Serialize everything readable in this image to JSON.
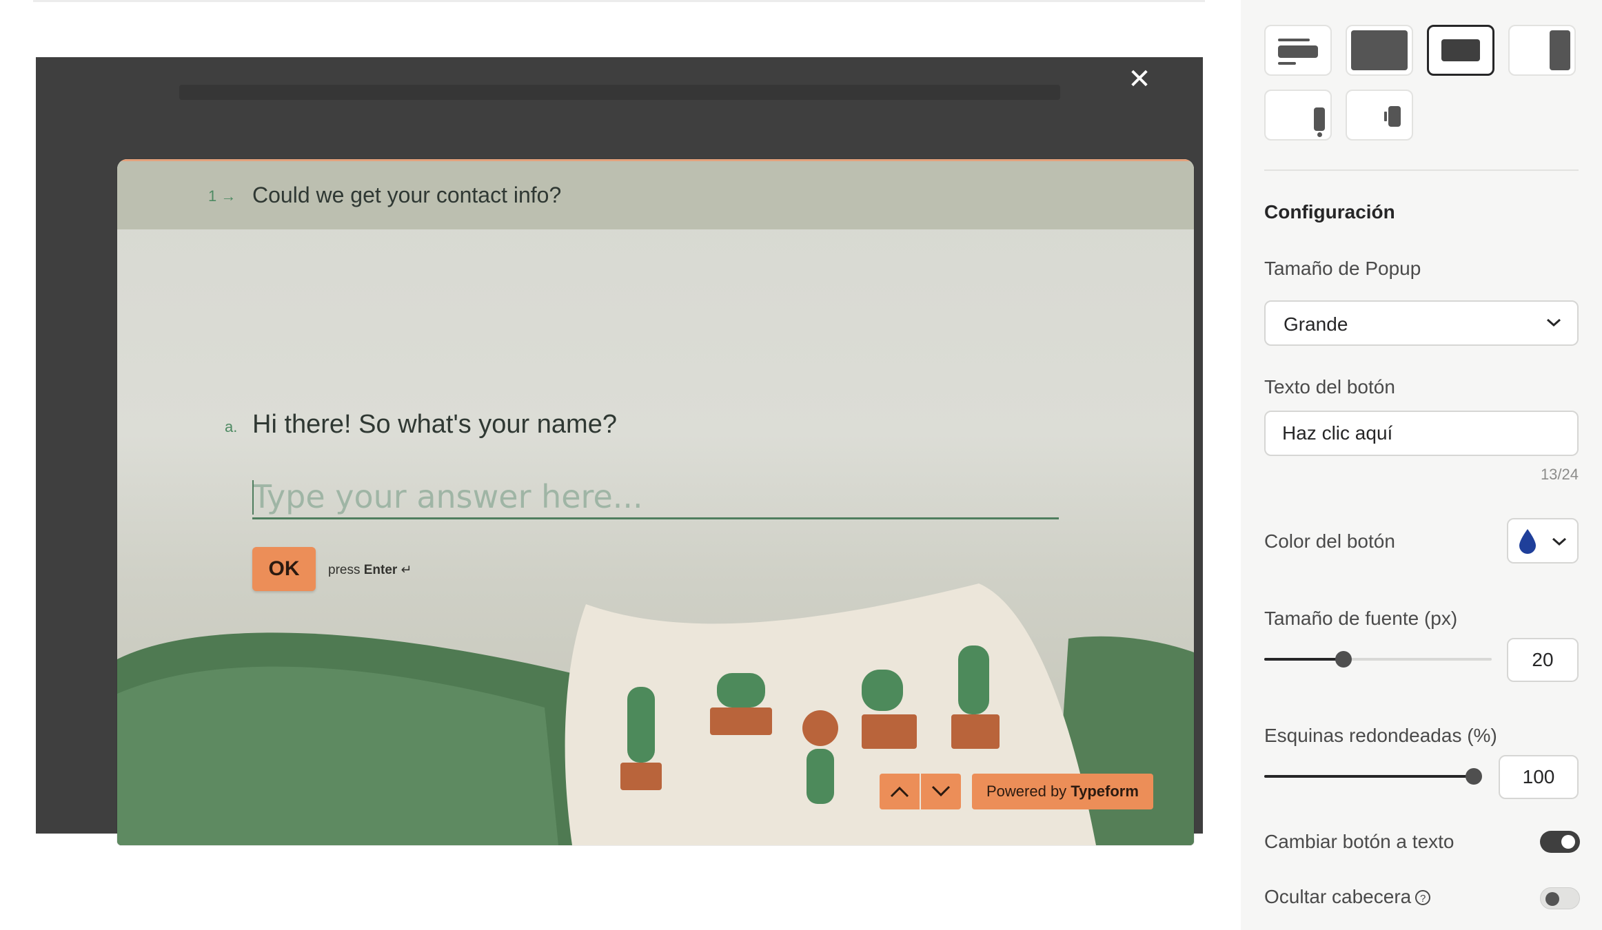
{
  "preview": {
    "close_icon": "close-icon",
    "header": {
      "number": "1",
      "arrow": "→",
      "text": "Could we get your contact info?"
    },
    "question": {
      "label": "a.",
      "text": "Hi there! So what's your name?"
    },
    "answer_placeholder": "Type your answer here...",
    "ok_label": "OK",
    "press_hint": {
      "prefix": "press",
      "key": "Enter",
      "symbol": "↵"
    },
    "nav": {
      "up_icon": "chevron-up-icon",
      "down_icon": "chevron-down-icon"
    },
    "powered": {
      "prefix": "Powered by",
      "brand": "Typeform"
    },
    "accent_color": "#ec8e58",
    "header_color": "#bcbfb0",
    "text_color": "#4e8a63"
  },
  "panel": {
    "layouts": [
      {
        "name": "layout-option-banner",
        "selected": false
      },
      {
        "name": "layout-option-fullpage",
        "selected": false
      },
      {
        "name": "layout-option-popup",
        "selected": true
      },
      {
        "name": "layout-option-side-panel",
        "selected": false
      },
      {
        "name": "layout-option-popover",
        "selected": false
      },
      {
        "name": "layout-option-side-tab",
        "selected": false
      }
    ],
    "section_title": "Configuración",
    "popup_size": {
      "label": "Tamaño de Popup",
      "value": "Grande"
    },
    "button_text": {
      "label": "Texto del botón",
      "value": "Haz clic aquí",
      "counter": "13/24"
    },
    "button_color": {
      "label": "Color del botón",
      "value": "#1f3f9a"
    },
    "font_size": {
      "label": "Tamaño de fuente (px)",
      "value": "20",
      "fraction": 0.35
    },
    "corners": {
      "label": "Esquinas redondeadas (%)",
      "value": "100",
      "fraction": 1.0
    },
    "button_to_text": {
      "label": "Cambiar botón a texto",
      "on": true
    },
    "hide_header": {
      "label": "Ocultar cabecera",
      "help_icon": "help-icon",
      "on": false
    }
  }
}
